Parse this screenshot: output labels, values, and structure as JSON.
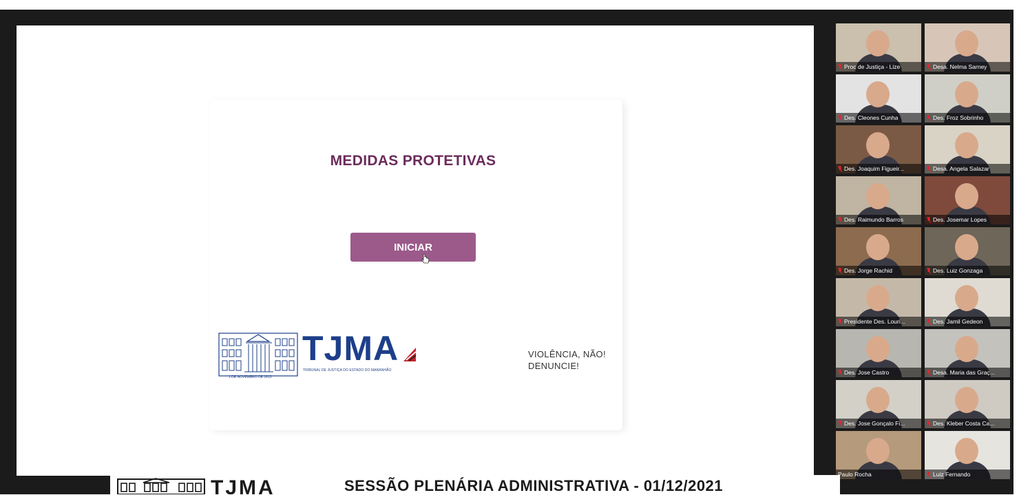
{
  "slide": {
    "title": "MEDIDAS PROTETIVAS",
    "start_button": "INICIAR",
    "logo_text": "TJMA",
    "logo_subtitle": "TRIBUNAL DE JUSTIÇA DO ESTADO DO MARANHÃO",
    "logo_founded": "1 DE NOVEMBRO DE 1813",
    "slogan_line1": "VIOLÊNCIA, NÃO!",
    "slogan_line2": "DENUNCIE!"
  },
  "participants": [
    {
      "name": "Proc de Justiça - Lize",
      "muted": true,
      "tone": "#cbbfae"
    },
    {
      "name": "Desa. Nelma Sarney",
      "muted": true,
      "tone": "#d7c6b8"
    },
    {
      "name": "Des. Cleones Cunha",
      "muted": true,
      "tone": "#e3e3e3"
    },
    {
      "name": "Des. Froz Sobrinho",
      "muted": true,
      "tone": "#cfcfc7"
    },
    {
      "name": "Des. Joaquim Figueir...",
      "muted": true,
      "tone": "#7a5a45"
    },
    {
      "name": "Desa. Angela Salazar",
      "muted": true,
      "tone": "#d9d3c6"
    },
    {
      "name": "Des. Raimundo Barros",
      "muted": true,
      "tone": "#bfb5a2"
    },
    {
      "name": "Des. Josemar Lopes",
      "muted": true,
      "tone": "#7f4a3c"
    },
    {
      "name": "Des. Jorge Rachid",
      "muted": true,
      "tone": "#8c6b4f"
    },
    {
      "name": "Des. Luiz Gonzaga",
      "muted": true,
      "tone": "#6e6658"
    },
    {
      "name": "Presidente Des. Louri...",
      "muted": true,
      "tone": "#c4b9a9"
    },
    {
      "name": "Des. Jamil Gedeon",
      "muted": true,
      "tone": "#dfdbd2"
    },
    {
      "name": "Des. Jose Castro",
      "muted": true,
      "tone": "#b8b6b0"
    },
    {
      "name": "Desa. Maria das Graç...",
      "muted": true,
      "tone": "#c3c2bc"
    },
    {
      "name": "Des. Jose Gonçalo Fi...",
      "muted": true,
      "tone": "#d3d0c8"
    },
    {
      "name": "Des. Kleber Costa Ca...",
      "muted": true,
      "tone": "#cfcac2"
    },
    {
      "name": "Paulo Rocha",
      "muted": false,
      "tone": "#b59a7b"
    },
    {
      "name": "Luiz Fernando",
      "muted": true,
      "tone": "#e6e4df"
    }
  ],
  "banner": {
    "logo_text": "TJMA",
    "title": "SESSÃO PLENÁRIA ADMINISTRATIVA - 01/12/2021"
  },
  "colors": {
    "accent": "#9c5a8a",
    "title": "#6b2c5b",
    "logo_blue": "#1d3f8a",
    "active_speaker": "#c8e04a"
  }
}
